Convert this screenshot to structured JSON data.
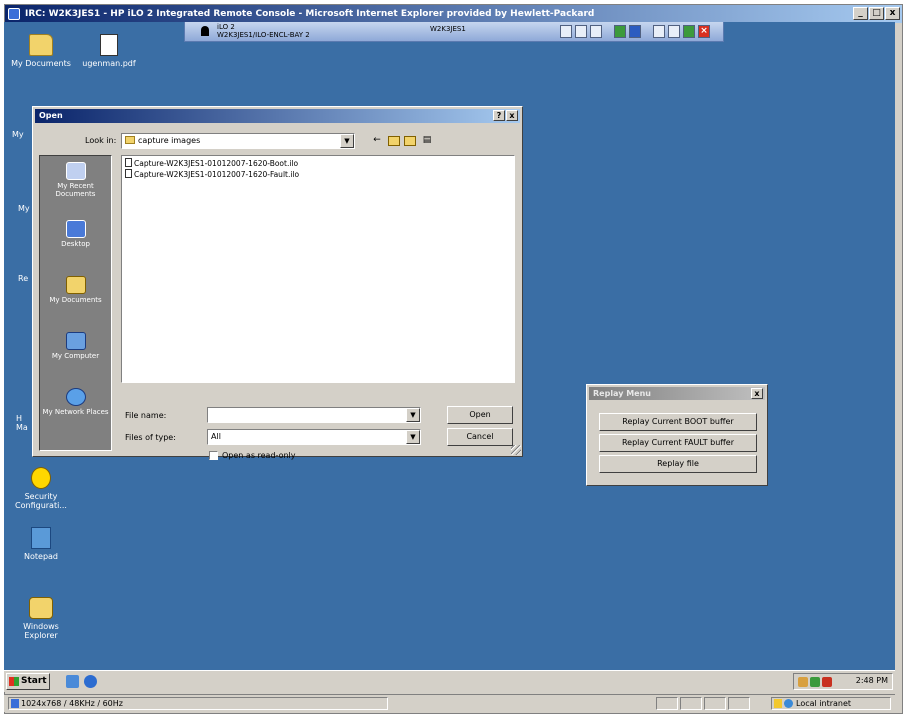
{
  "ie_window": {
    "title": "IRC: W2K3JES1 - HP iLO 2 Integrated Remote Console - Microsoft Internet Explorer provided by Hewlett-Packard",
    "min": "_",
    "max": "□",
    "close": "x"
  },
  "ilo_bar": {
    "left_line1": "iLO 2",
    "left_line2": "W2K3JES1/ILO-ENCL-BAY 2",
    "host": "W2K3JES1"
  },
  "desktop": {
    "icons": [
      {
        "label": "My Documents"
      },
      {
        "label": "ugenman.pdf"
      },
      {
        "label": "Security Configurati..."
      },
      {
        "label": "Notepad"
      },
      {
        "label": "Windows Explorer"
      }
    ],
    "clipped_labels": [
      "My",
      "My",
      "Re",
      "H\nMa"
    ]
  },
  "open_dialog": {
    "title": "Open",
    "help": "?",
    "close": "x",
    "look_in_label": "Look in:",
    "look_in_value": "capture images",
    "places": [
      "My Recent Documents",
      "Desktop",
      "My Documents",
      "My Computer",
      "My Network Places"
    ],
    "files": [
      "Capture-W2K3JES1-01012007-1620-Boot.ilo",
      "Capture-W2K3JES1-01012007-1620-Fault.ilo"
    ],
    "file_name_label": "File name:",
    "file_name_value": "",
    "files_of_type_label": "Files of type:",
    "files_of_type_value": "All",
    "readonly_label": "Open as read-only",
    "open_button": "Open",
    "cancel_button": "Cancel"
  },
  "replay_menu": {
    "title": "Replay Menu",
    "close": "x",
    "buttons": [
      "Replay Current BOOT buffer",
      "Replay Current FAULT buffer",
      "Replay file"
    ]
  },
  "taskbar": {
    "start": "Start",
    "clock": "2:48 PM"
  },
  "statusbar": {
    "text": "1024x768 / 48KHz / 60Hz",
    "zone": "Local intranet"
  }
}
